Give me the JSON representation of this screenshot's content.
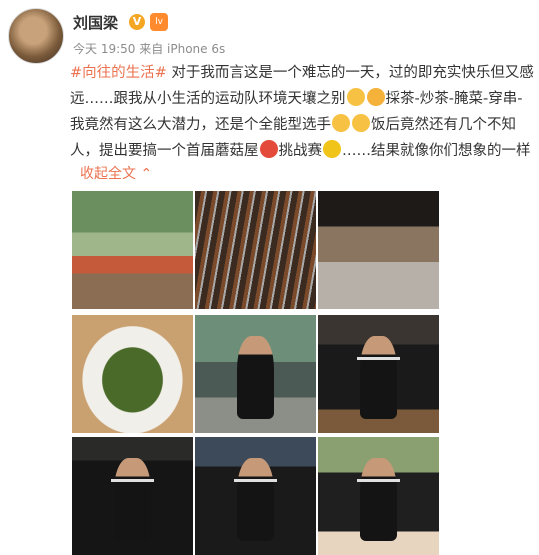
{
  "post": {
    "username": "刘国梁",
    "verified_mark": "V",
    "level_badge": "lv",
    "meta": "今天 19:50 来自 iPhone 6s",
    "content": {
      "line1_topic": "#向往的生活#",
      "line1_text": " 对于我而言这是一个难忘的一天，过的即充实快乐但又感",
      "line2_text_a": "远……跟我从小生活的运动队环境天壤之别",
      "line2_text_b": "採茶-炒茶-腌菜-穿串-",
      "line3_text_a": "我竟然有这么大潜力，还是个全能型选手",
      "line3_text_b": "饭后竟然还有几个不知",
      "line4_text_a": "人，提出要搞一个首届蘑菇屋",
      "line4_text_b": "挑战赛",
      "line4_text_c": "……结果就像你们想象的一样"
    },
    "expand_label": "收起全文",
    "expand_chevron": "⌃"
  },
  "images": [
    {
      "icon": "group-photo"
    },
    {
      "icon": "bbq-skewers"
    },
    {
      "icon": "grilled-food"
    },
    {
      "icon": "stir-fried-vegetables"
    },
    {
      "icon": "statue-portrait"
    },
    {
      "icon": "man-with-paddle"
    },
    {
      "icon": "man-with-paddle"
    },
    {
      "icon": "man-with-paddle"
    },
    {
      "icon": "man-with-paddle"
    }
  ],
  "colors": {
    "topic": "#eb7350",
    "meta": "#8c8c8c",
    "text": "#333333"
  }
}
